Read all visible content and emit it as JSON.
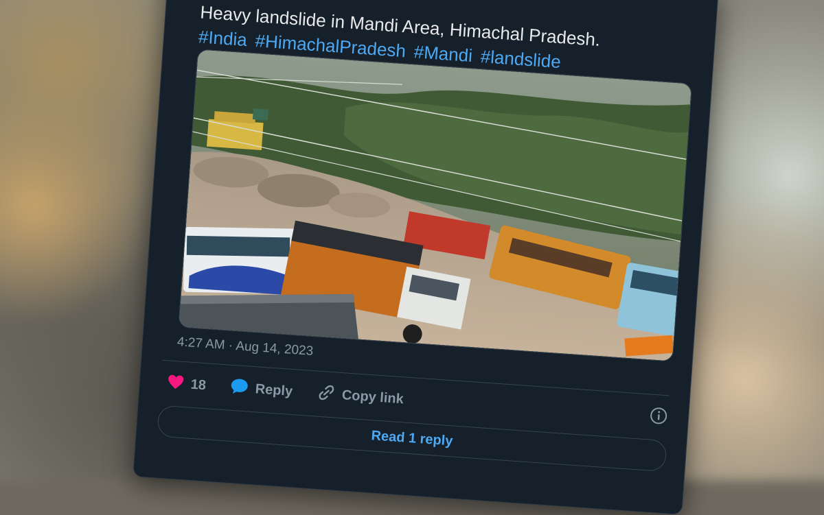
{
  "tweet": {
    "text_line": "Heavy landslide in Mandi Area, Himachal Pradesh.",
    "hashtags": [
      "#India",
      "#HimachalPradesh",
      "#Mandi",
      "#landslide"
    ],
    "timestamp": "4:27 AM · Aug 14, 2023"
  },
  "actions": {
    "like_count": "18",
    "reply_label": "Reply",
    "copy_label": "Copy link",
    "read_replies_label": "Read 1 reply"
  },
  "icons": {
    "like": "heart-icon",
    "reply": "speech-bubble-icon",
    "copy": "link-icon",
    "info": "info-icon"
  },
  "colors": {
    "card_bg": "#15202b",
    "hashtag": "#4ea9f2",
    "heart": "#f91880",
    "reply_icon": "#1d9bf0",
    "muted_text": "#8b98a5"
  }
}
